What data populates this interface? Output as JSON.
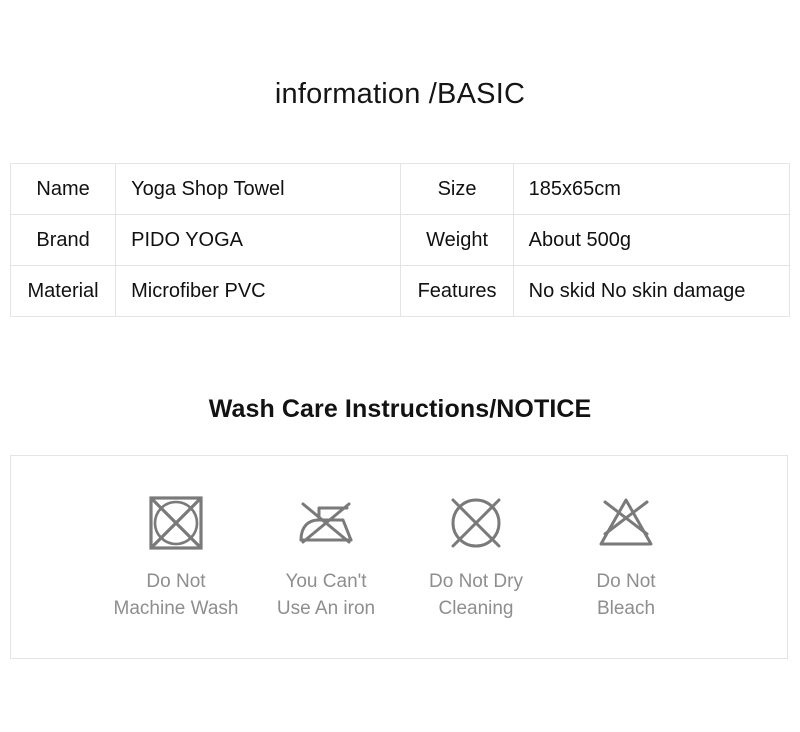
{
  "basic": {
    "title": "information /BASIC",
    "table": {
      "rows": [
        {
          "label_a": "Name",
          "value_a": "Yoga Shop Towel",
          "label_b": "Size",
          "value_b": "185x65cm"
        },
        {
          "label_a": "Brand",
          "value_a": "PIDO YOGA",
          "label_b": "Weight",
          "value_b": "About 500g"
        },
        {
          "label_a": "Material",
          "value_a": "Microfiber PVC",
          "label_b": "Features",
          "value_b": "No skid No skin damage"
        }
      ]
    }
  },
  "care": {
    "title": "Wash Care Instructions/NOTICE",
    "items": [
      {
        "icon": "no-machine-wash-icon",
        "line1": "Do Not",
        "line2": "Machine Wash"
      },
      {
        "icon": "no-iron-icon",
        "line1": "You Can't",
        "line2": "Use An iron"
      },
      {
        "icon": "no-dry-clean-icon",
        "line1": "Do Not Dry",
        "line2": "Cleaning"
      },
      {
        "icon": "no-bleach-icon",
        "line1": "Do Not",
        "line2": "Bleach"
      }
    ]
  },
  "colors": {
    "page_background": "#ffffff",
    "heading_text": "#151515",
    "table_text": "#111111",
    "table_border": "#e4e4e4",
    "care_icon_stroke": "#7a7a7a",
    "care_label_text": "#8e8e8e"
  }
}
